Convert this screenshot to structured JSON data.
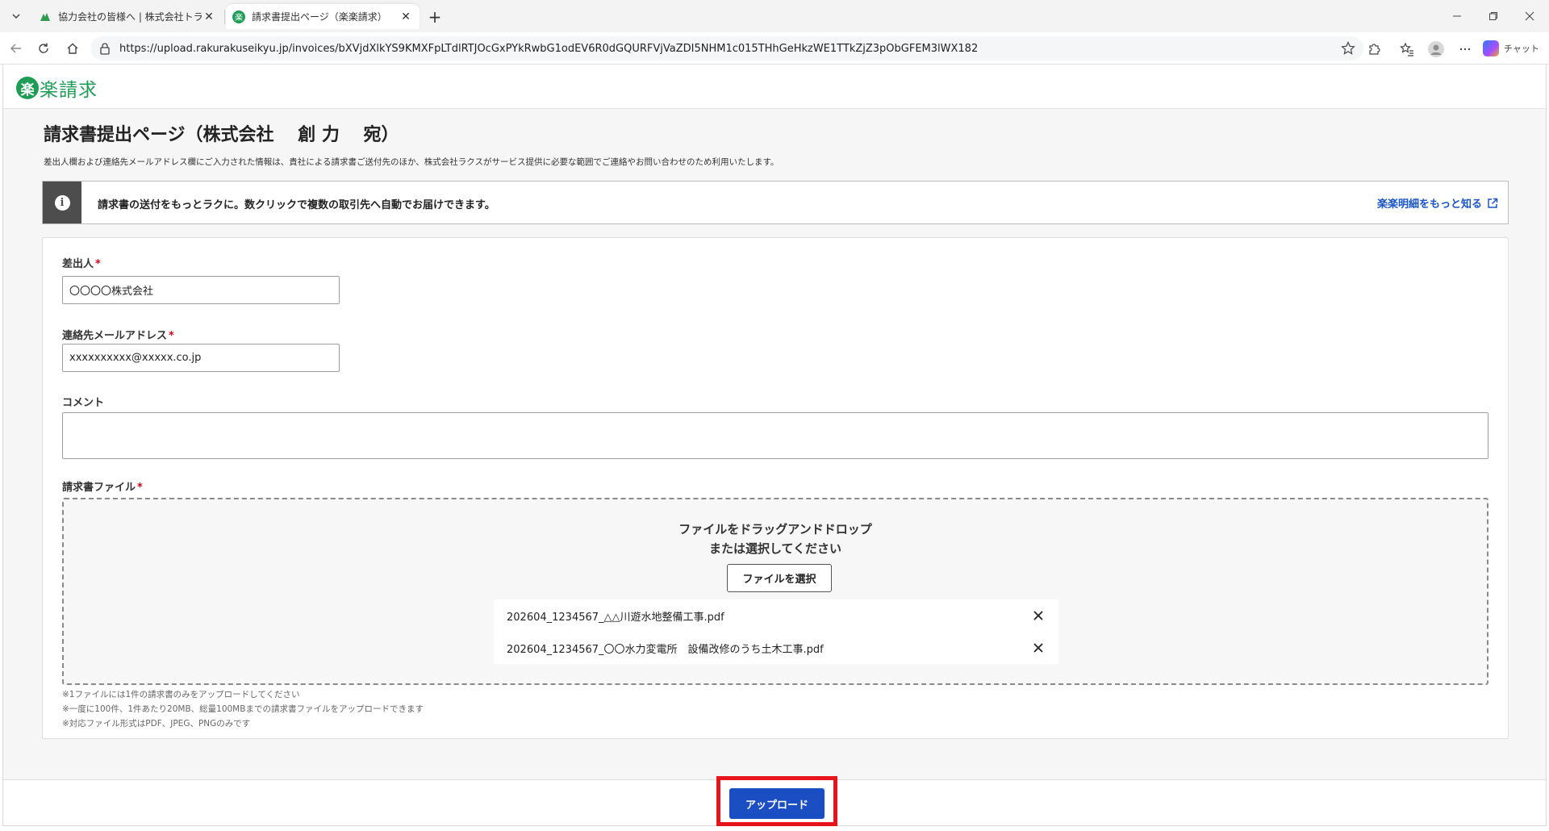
{
  "browser": {
    "tabs": [
      {
        "title": "協力会社の皆様へ | 株式会社トライ",
        "active": false
      },
      {
        "title": "請求書提出ページ（楽楽請求）",
        "active": true
      }
    ],
    "url": "https://upload.rakurakuseikyu.jp/invoices/bXVjdXlkYS9KMXFpLTdlRTJOcGxPYkRwbG1odEV6R0dGQURFVjVaZDI5NHM1c015THhGeHkzWE1TTkZjZ3pObGFEM3lWX182",
    "copilot_label": "チャット"
  },
  "site": {
    "logo_mark": "楽",
    "logo_text": "楽請求"
  },
  "page": {
    "title": "請求書提出ページ（株式会社　 創 力 　宛）",
    "notice": "差出人欄および連絡先メールアドレス欄にご入力された情報は、貴社による請求書ご送付先のほか、株式会社ラクスがサービス提供に必要な範囲でご連絡やお問い合わせのため利用いたします。"
  },
  "promo": {
    "text": "請求書の送付をもっとラクに。数クリックで複数の取引先へ自動でお届けできます。",
    "link": "楽楽明細をもっと知る"
  },
  "form": {
    "sender": {
      "label": "差出人",
      "required_mark": "*",
      "value": "〇〇〇〇株式会社"
    },
    "email": {
      "label": "連絡先メールアドレス",
      "required_mark": "*",
      "value": "xxxxxxxxxx@xxxxx.co.jp"
    },
    "comment": {
      "label": "コメント",
      "value": ""
    },
    "invoice_file": {
      "label": "請求書ファイル",
      "required_mark": "*",
      "drop_line1": "ファイルをドラッグアンドドロップ",
      "drop_line2": "または選択してください",
      "choose_button": "ファイルを選択",
      "files": [
        "202604_1234567_△△川遊水地整備工事.pdf",
        "202604_1234567_〇〇水力変電所　設備改修のうち土木工事.pdf"
      ]
    },
    "notes": [
      "※1ファイルには1件の請求書のみをアップロードしてください",
      "※一度に100件、1件あたり20MB、総量100MBまでの請求書ファイルをアップロードできます",
      "※対応ファイル形式はPDF、JPEG、PNGのみです"
    ],
    "upload_button": "アップロード"
  },
  "colors": {
    "brand_green": "#1f9d57",
    "primary_blue": "#1a4ec2",
    "link_blue": "#1a56c7",
    "required_red": "#d0021b",
    "highlight_red": "#e8141c"
  },
  "icons": {
    "info": "i",
    "close": "✕"
  }
}
